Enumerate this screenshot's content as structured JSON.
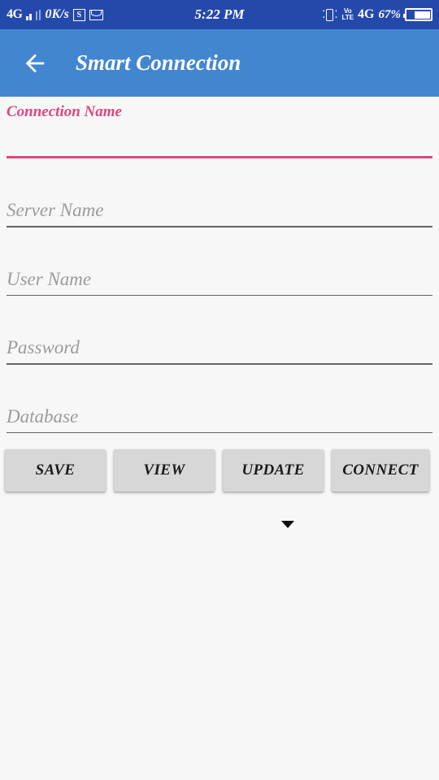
{
  "status_bar": {
    "network_type": "4G",
    "data_speed": "0K/s",
    "sim_icon_label": "S",
    "mail_icon": "mail-icon",
    "time": "5:22 PM",
    "vibrate_icon": "vibrate-icon",
    "volte_top": "VoLTE",
    "volte_line1": "Vo",
    "volte_line2": "LTE",
    "network_type_right": "4G",
    "battery_percent": "67%",
    "background_color": "#2549ab"
  },
  "app_bar": {
    "back_icon": "arrow-left-icon",
    "title": "Smart Connection",
    "background_color": "#4286d0"
  },
  "form": {
    "accent_color": "#e0457f",
    "fields": [
      {
        "name": "connection-name",
        "label": "Connection Name",
        "value": "",
        "placeholder": "Connection Name",
        "focused": true
      },
      {
        "name": "server-name",
        "label": "Server Name",
        "value": "",
        "placeholder": "Server Name",
        "focused": false
      },
      {
        "name": "user-name",
        "label": "User Name",
        "value": "",
        "placeholder": "User Name",
        "focused": false
      },
      {
        "name": "password",
        "label": "Password",
        "value": "",
        "placeholder": "Password",
        "focused": false
      },
      {
        "name": "database",
        "label": "Database",
        "value": "",
        "placeholder": "Database",
        "focused": false
      }
    ]
  },
  "buttons": {
    "save": "SAVE",
    "view": "VIEW",
    "update": "UPDATE",
    "connect": "CONNECT"
  },
  "spinner": {
    "icon": "chevron-down-icon",
    "selected_value": ""
  }
}
